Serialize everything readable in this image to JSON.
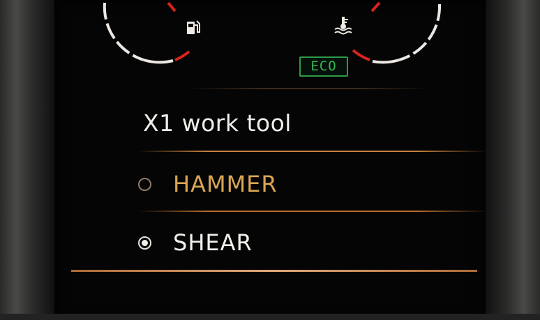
{
  "eco_badge": {
    "label": "ECO",
    "color": "#36b653"
  },
  "gauges": {
    "left_icon": "fuel-pump-icon",
    "right_icon": "coolant-temperature-icon",
    "accent_color": "#d8231c"
  },
  "menu": {
    "title": "X1 work tool",
    "options": [
      {
        "label": "HAMMER",
        "selected": false,
        "color": "#d9a654"
      },
      {
        "label": "SHEAR",
        "selected": true,
        "color": "#f2f0ec"
      }
    ]
  }
}
